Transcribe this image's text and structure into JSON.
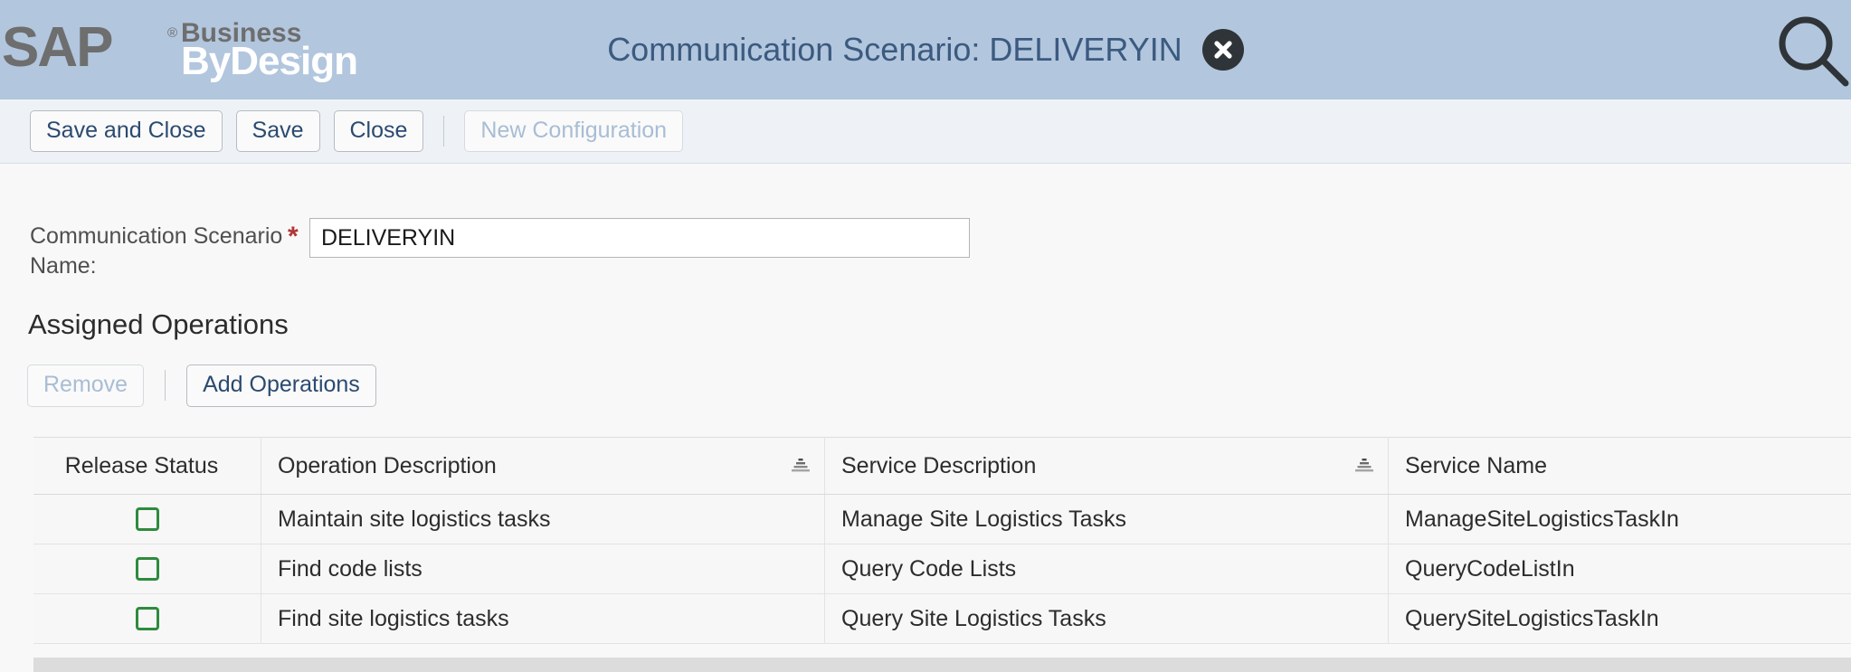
{
  "header": {
    "logo": {
      "sap": "SAP",
      "registered": "®",
      "business": "Business",
      "bydesign": "ByDesign",
      "bydesign_mark": "·"
    },
    "title": "Communication Scenario: DELIVERYIN",
    "close_icon_name": "close-icon",
    "search_icon_name": "search-icon"
  },
  "toolbar": {
    "save_and_close_label": "Save and Close",
    "save_label": "Save",
    "close_label": "Close",
    "new_configuration_label": "New Configuration",
    "new_configuration_disabled": true
  },
  "form": {
    "scenario_name_label": "Communication Scenario Name:",
    "required_marker": "*",
    "scenario_name_value": "DELIVERYIN",
    "scenario_name_placeholder": ""
  },
  "assigned_operations": {
    "section_title": "Assigned Operations",
    "remove_label": "Remove",
    "remove_disabled": true,
    "add_operations_label": "Add Operations",
    "columns": [
      {
        "label": "Release Status",
        "sortable": false
      },
      {
        "label": "Operation Description",
        "sortable": true
      },
      {
        "label": "Service Description",
        "sortable": true
      },
      {
        "label": "Service Name",
        "sortable": false
      }
    ],
    "rows": [
      {
        "release_status": "released",
        "operation_description": "Maintain site logistics tasks",
        "service_description": "Manage Site Logistics Tasks",
        "service_name": "ManageSiteLogisticsTaskIn"
      },
      {
        "release_status": "released",
        "operation_description": "Find code lists",
        "service_description": "Query Code Lists",
        "service_name": "QueryCodeListIn"
      },
      {
        "release_status": "released",
        "operation_description": "Find site logistics tasks",
        "service_description": "Query Site Logistics Tasks",
        "service_name": "QuerySiteLogisticsTaskIn"
      }
    ]
  },
  "colors": {
    "header_band": "#b2c6de",
    "header_title": "#3b5a7f",
    "button_text": "#2b4a70",
    "disabled_text": "#a8bdd4",
    "required_star": "#b03535",
    "status_green": "#2e8b3d"
  }
}
